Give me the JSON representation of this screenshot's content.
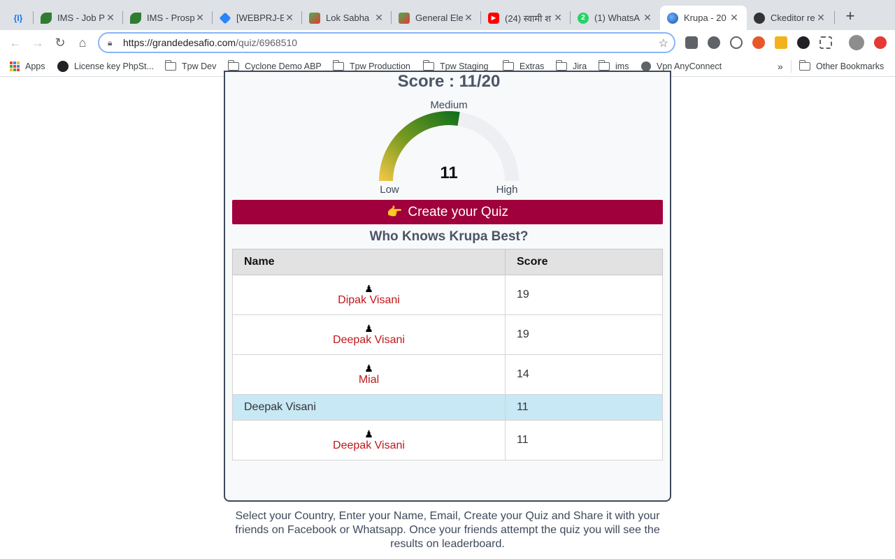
{
  "browser": {
    "tabs": [
      {
        "title": "{I}",
        "icon": "braces-icon"
      },
      {
        "title": "IMS - Job P",
        "icon": "ims-logo-icon"
      },
      {
        "title": "IMS - Prosp",
        "icon": "ims-logo-icon"
      },
      {
        "title": "[WEBPRJ-E",
        "icon": "jira-icon"
      },
      {
        "title": "Lok Sabha",
        "icon": "ballot-icon"
      },
      {
        "title": "General Ele",
        "icon": "ballot-icon"
      },
      {
        "title": "(24) स्वामी श",
        "icon": "youtube-icon"
      },
      {
        "title": "(1) WhatsA",
        "icon": "whatsapp-icon"
      },
      {
        "title": "Krupa - 20",
        "icon": "globe-icon"
      },
      {
        "title": "Ckeditor re",
        "icon": "ckeditor-icon"
      }
    ],
    "new_tab_label": "+",
    "url_host": "https://grandedesafio.com",
    "url_path": "/quiz/6968510",
    "bookmarks": [
      {
        "label": "Apps"
      },
      {
        "label": "License key PhpSt..."
      },
      {
        "label": "Tpw Dev"
      },
      {
        "label": "Cyclone Demo ABP"
      },
      {
        "label": "Tpw Production"
      },
      {
        "label": "Tpw Staging"
      },
      {
        "label": "Extras"
      },
      {
        "label": "Jira"
      },
      {
        "label": "ims"
      },
      {
        "label": "Vpn AnyConnect"
      }
    ],
    "bookmarks_overflow": "»",
    "other_bookmarks": "Other Bookmarks"
  },
  "quiz": {
    "score_text": "Score : 11/20",
    "gauge": {
      "value": 11,
      "value_label": "11",
      "max": 20,
      "low_label": "Low",
      "medium_label": "Medium",
      "high_label": "High"
    },
    "create_button_label": "Create your Quiz",
    "create_button_emoji": "👉",
    "leaderboard_title": "Who Knows Krupa Best?",
    "table": {
      "headers": [
        "Name",
        "Score"
      ],
      "rows": [
        {
          "name": "Dipak Visani",
          "score": "19"
        },
        {
          "name": "Deepak Visani",
          "score": "19"
        },
        {
          "name": "Mial",
          "score": "14"
        },
        {
          "name": "Deepak Visani",
          "score": "11"
        },
        {
          "name": "Deepak Visani",
          "score": "11"
        }
      ]
    },
    "footer": "Select your Country, Enter your Name, Email, Create your Quiz and Share it with your friends on Facebook or Whatsapp. Once your friends attempt the quiz you will see the results on leaderboard."
  },
  "colors": {
    "create_button": "#a0003b",
    "name_red": "#c0171b",
    "highlight_row": "#c7e8f4",
    "gauge_low": "#f7c948",
    "gauge_high": "#0b6e1e"
  }
}
